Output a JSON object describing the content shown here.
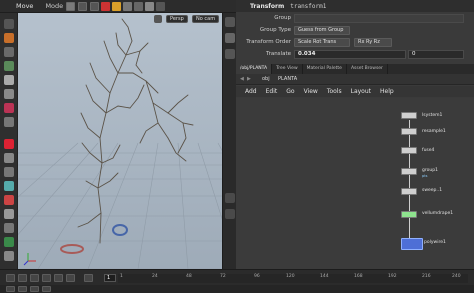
{
  "topbar": {
    "mode_left": "Move",
    "mode_right": "Mode"
  },
  "viewport": {
    "camera_menu": "Persp",
    "camera_dropdown": "No cam"
  },
  "params": {
    "node_type": "Transform",
    "node_name": "transform1",
    "rows": [
      {
        "label": "Group",
        "value": ""
      },
      {
        "label": "Group Type",
        "value": "Guess from Group"
      },
      {
        "label": "Transform Order",
        "value": "Scale Rot Trans",
        "value2": "Rx Ry Rz"
      },
      {
        "label": "Translate",
        "value": "0.034",
        "value2": "0"
      }
    ]
  },
  "tabs": [
    "/obj/PLANTA",
    "Tree View",
    "Material Palette",
    "Asset Browser"
  ],
  "pathbar": {
    "root": "obj",
    "current": "PLANTA"
  },
  "menubar": [
    "Add",
    "Edit",
    "Go",
    "View",
    "Tools",
    "Layout",
    "Help"
  ],
  "nodes": [
    {
      "label": "lsystem1",
      "sub": ""
    },
    {
      "label": "resample1",
      "sub": ""
    },
    {
      "label": "fuse4",
      "sub": ""
    },
    {
      "label": "group1",
      "sub": "pts"
    },
    {
      "label": "sweep..1",
      "sub": ""
    },
    {
      "label": "vellumdrape1",
      "sub": ""
    },
    {
      "label": "polywire1",
      "sub": ""
    }
  ],
  "timeline": {
    "frame": "1",
    "ticks": [
      "1",
      "24",
      "48",
      "72",
      "96",
      "120",
      "144",
      "168",
      "192",
      "216",
      "240"
    ]
  },
  "colors": {
    "viewport_top": "#b5c1cd",
    "viewport_bottom": "#9eabb8",
    "node_selected": "#4e6fd6",
    "node_vellum": "#8ee38e"
  }
}
